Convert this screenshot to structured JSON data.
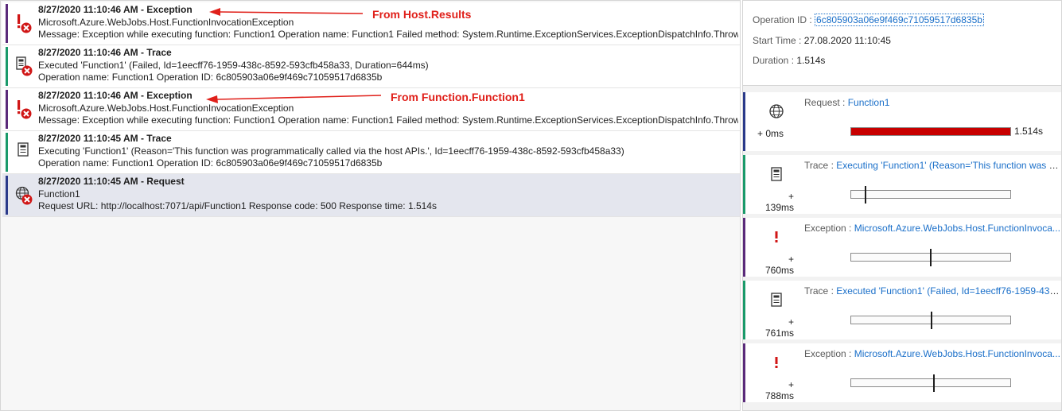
{
  "colors": {
    "exception_bar": "#5a2a7a",
    "trace_bar": "#1a9a6a",
    "request_bar": "#2a3a8a",
    "annotation": "#e0201a",
    "link": "#1a6fc9",
    "timeline_fill": "#c80000"
  },
  "events": [
    {
      "kind": "exception",
      "icon": "exception-error-icon",
      "title": "8/27/2020 11:10:46 AM - Exception",
      "line2": "Microsoft.Azure.WebJobs.Host.FunctionInvocationException",
      "line3": "Message: Exception while executing function: Function1  Operation name: Function1  Failed method: System.Runtime.ExceptionServices.ExceptionDispatchInfo.Throw"
    },
    {
      "kind": "trace",
      "icon": "trace-error-icon",
      "title": "8/27/2020 11:10:46 AM - Trace",
      "line2": "Executed 'Function1' (Failed, Id=1eecff76-1959-438c-8592-593cfb458a33, Duration=644ms)",
      "line3": "Operation name: Function1  Operation ID: 6c805903a06e9f469c71059517d6835b"
    },
    {
      "kind": "exception",
      "icon": "exception-error-icon",
      "title": "8/27/2020 11:10:46 AM - Exception",
      "line2": "Microsoft.Azure.WebJobs.Host.FunctionInvocationException",
      "line3": "Message: Exception while executing function: Function1  Operation name: Function1  Failed method: System.Runtime.ExceptionServices.ExceptionDispatchInfo.Throw"
    },
    {
      "kind": "trace",
      "icon": "trace-icon",
      "title": "8/27/2020 11:10:45 AM - Trace",
      "line2": "Executing 'Function1' (Reason='This function was programmatically called via the host APIs.', Id=1eecff76-1959-438c-8592-593cfb458a33)",
      "line3": "Operation name: Function1  Operation ID: 6c805903a06e9f469c71059517d6835b"
    },
    {
      "kind": "request",
      "icon": "request-globe-error-icon",
      "title": "8/27/2020 11:10:45 AM - Request",
      "line2": "Function1",
      "line3": "Request URL: http://localhost:7071/api/Function1  Response code: 500  Response time: 1.514s",
      "selected": true
    }
  ],
  "annotations": {
    "first": "From Host.Results",
    "second": "From Function.Function1"
  },
  "details": {
    "operation_id_label": "Operation ID :",
    "operation_id": "6c805903a06e9f469c71059517d6835b",
    "start_time_label": "Start Time :",
    "start_time": "27.08.2020 11:10:45",
    "duration_label": "Duration :",
    "duration": "1.514s"
  },
  "timeline": [
    {
      "kind": "request",
      "icon": "globe-icon",
      "label": "Request :",
      "value": "Function1",
      "offset": "+ 0ms",
      "fill_fraction": 1.0,
      "duration": "1.514s"
    },
    {
      "kind": "trace",
      "icon": "trace-icon",
      "label": "Trace :",
      "value": "Executing 'Function1' (Reason='This function was p...",
      "offset": "+ 139ms",
      "tick_fraction": 0.092
    },
    {
      "kind": "exception",
      "icon": "exclamation-icon",
      "label": "Exception :",
      "value": "Microsoft.Azure.WebJobs.Host.FunctionInvoca...",
      "offset": "+ 760ms",
      "tick_fraction": 0.502
    },
    {
      "kind": "trace",
      "icon": "trace-icon",
      "label": "Trace :",
      "value": "Executed 'Function1' (Failed, Id=1eecff76-1959-438c...",
      "offset": "+ 761ms",
      "tick_fraction": 0.503
    },
    {
      "kind": "exception",
      "icon": "exclamation-icon",
      "label": "Exception :",
      "value": "Microsoft.Azure.WebJobs.Host.FunctionInvoca...",
      "offset": "+ 788ms",
      "tick_fraction": 0.521
    }
  ]
}
